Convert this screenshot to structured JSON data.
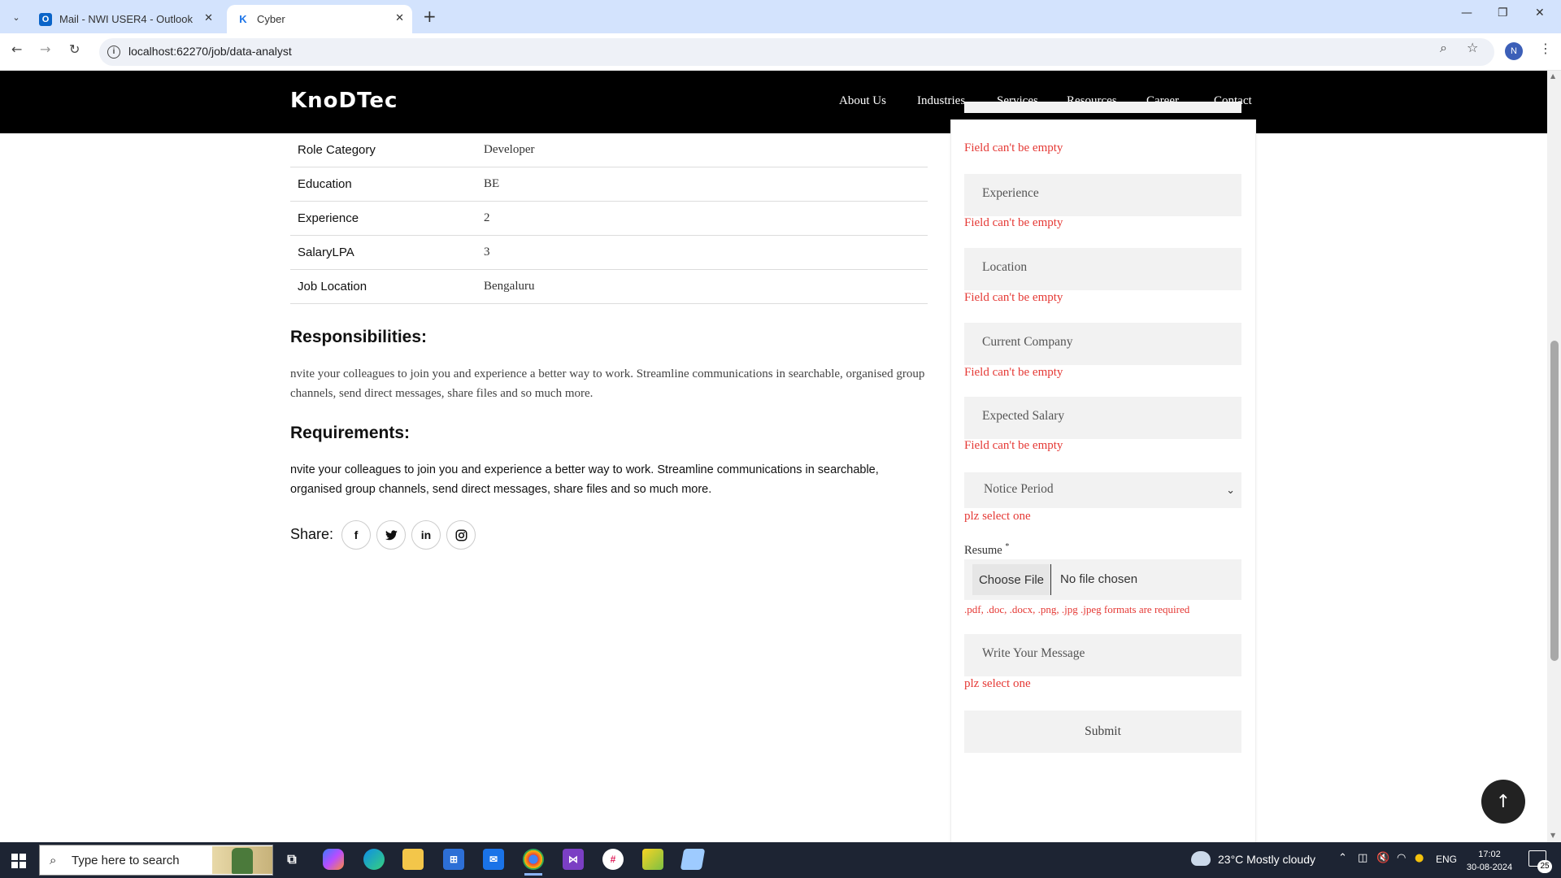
{
  "browser": {
    "tabs": [
      {
        "title": "Mail - NWI USER4 - Outlook",
        "icon": "outlook-icon"
      },
      {
        "title": "Cyber",
        "icon": "k-favicon"
      }
    ],
    "new_tab_label": "+",
    "url": "localhost:62270/job/data-analyst",
    "profile_initial": "N"
  },
  "site": {
    "logo": "KnoDTec",
    "nav": [
      "About Us",
      "Industries",
      "Services",
      "Resources",
      "Career",
      "Contact"
    ]
  },
  "job_details": [
    {
      "label": "Role Category",
      "value": "Developer"
    },
    {
      "label": "Education",
      "value": "BE"
    },
    {
      "label": "Experience",
      "value": "2"
    },
    {
      "label": "SalaryLPA",
      "value": "3"
    },
    {
      "label": "Job Location",
      "value": "Bengaluru"
    }
  ],
  "responsibilities": {
    "heading": "Responsibilities:",
    "text": "nvite your colleagues to join you and experience a better way to work. Streamline communications in searchable, organised group channels, send direct messages, share files and so much more."
  },
  "requirements": {
    "heading": "Requirements:",
    "text": "nvite your colleagues to join you and experience a better way to work. Streamline communications in searchable, organised group channels, send direct messages, share files and so much more."
  },
  "share": {
    "label": "Share:",
    "networks": [
      {
        "name": "facebook",
        "glyph": "f"
      },
      {
        "name": "twitter",
        "glyph": "🐦"
      },
      {
        "name": "linkedin",
        "glyph": "in"
      },
      {
        "name": "instagram",
        "glyph": "◎"
      }
    ]
  },
  "form": {
    "top_error": "Field can't be empty",
    "fields": [
      {
        "placeholder": "Experience",
        "error": "Field can't be empty"
      },
      {
        "placeholder": "Location",
        "error": "Field can't be empty"
      },
      {
        "placeholder": "Current Company",
        "error": "Field can't be empty"
      },
      {
        "placeholder": "Expected Salary",
        "error": "Field can't be empty"
      }
    ],
    "notice_period": {
      "selected": "Notice Period",
      "error": "plz select one"
    },
    "resume": {
      "label": "Resume",
      "required_mark": "*",
      "button": "Choose File",
      "status": "No file chosen",
      "formats_hint": ".pdf, .doc, .docx, .png, .jpg .jpeg formats are required"
    },
    "message": {
      "placeholder": "Write Your Message",
      "error": "plz select one"
    },
    "submit_label": "Submit"
  },
  "back_to_top_icon": "arrow-up-icon",
  "taskbar": {
    "search_placeholder": "Type here to search",
    "weather": "23°C  Mostly cloudy",
    "language": "ENG",
    "time": "17:02",
    "date": "30-08-2024",
    "notification_count": "25"
  },
  "colors": {
    "header_bg": "#000000",
    "error": "#e53935",
    "field_bg": "#f2f2f2",
    "tabbar_bg": "#d3e3fd",
    "taskbar_bg": "#1d2433"
  }
}
